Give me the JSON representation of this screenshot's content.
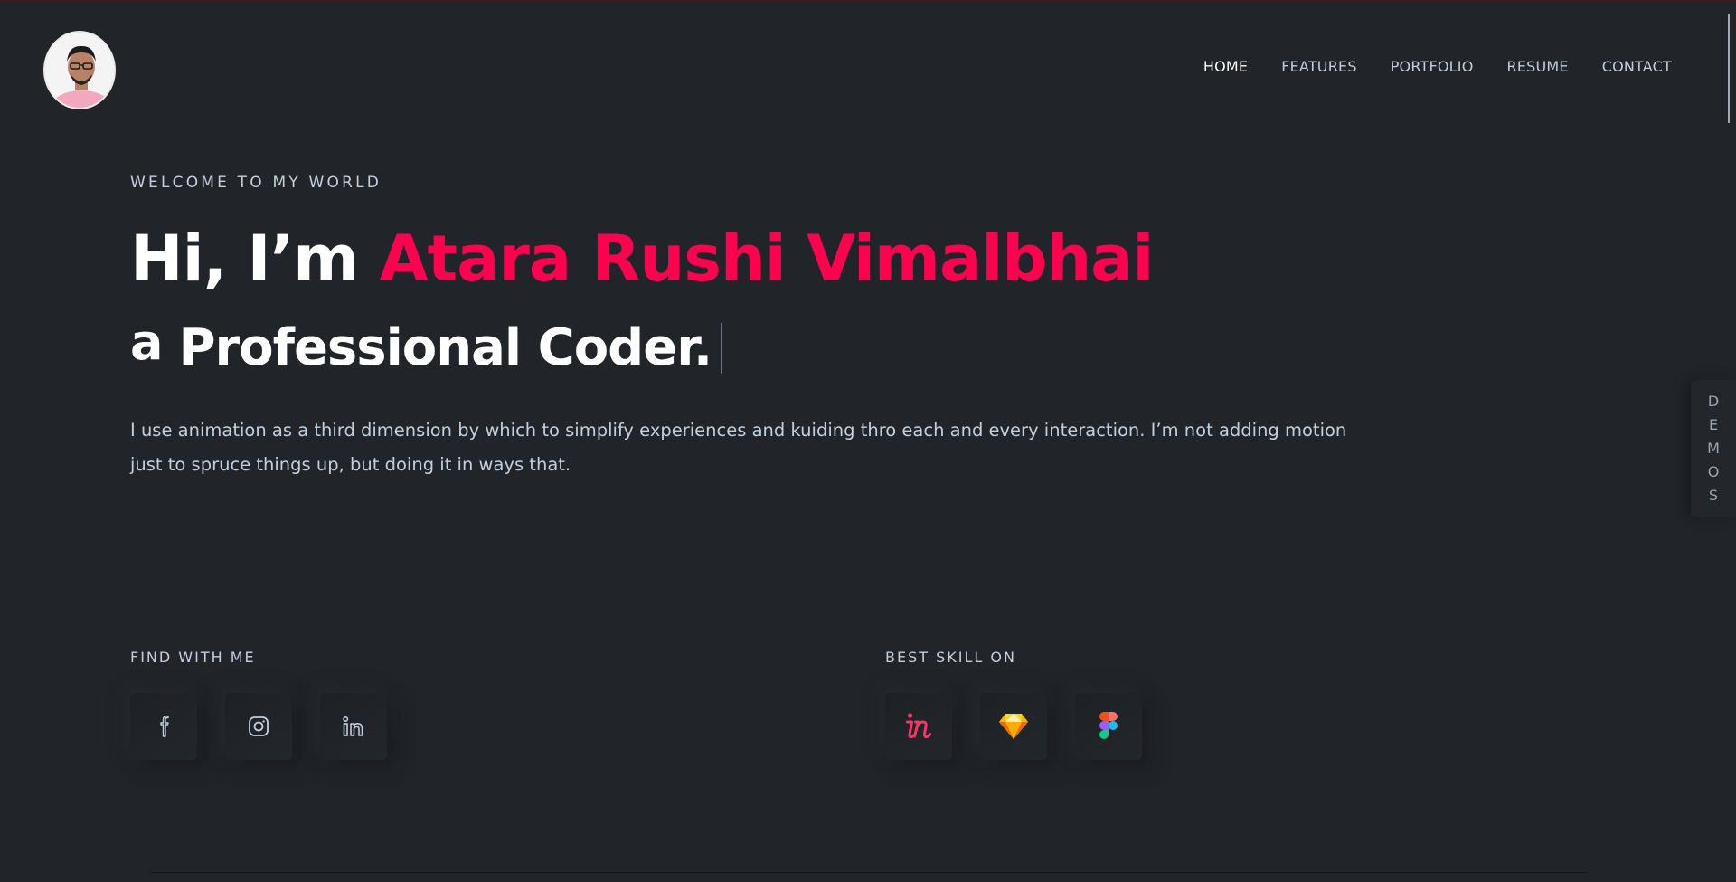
{
  "header": {
    "nav": [
      "HOME",
      "FEATURES",
      "PORTFOLIO",
      "RESUME",
      "CONTACT"
    ],
    "active_nav": "HOME"
  },
  "hero": {
    "welcome": "WELCOME TO MY WORLD",
    "greeting": "Hi, I’m ",
    "name": "Atara Rushi Vimalbhai",
    "subtitle_prefix": "a",
    "subtitle_role": "Professional Coder.",
    "description": "I use animation as a third dimension by which to simplify experiences and kuiding thro each and every interaction. I’m not adding motion just to spruce things up, but doing it in ways that."
  },
  "demos": [
    "D",
    "E",
    "M",
    "O",
    "S"
  ],
  "find_with_me": {
    "label": "FIND WITH ME",
    "icons": [
      "facebook-icon",
      "instagram-icon",
      "linkedin-icon"
    ]
  },
  "best_skill_on": {
    "label": "BEST SKILL ON",
    "icons": [
      "invision-icon",
      "sketch-icon",
      "figma-icon"
    ]
  },
  "colors": {
    "background": "#212428",
    "accent": "#ff014f",
    "text": "#c4cfde",
    "heading": "#ffffff"
  }
}
